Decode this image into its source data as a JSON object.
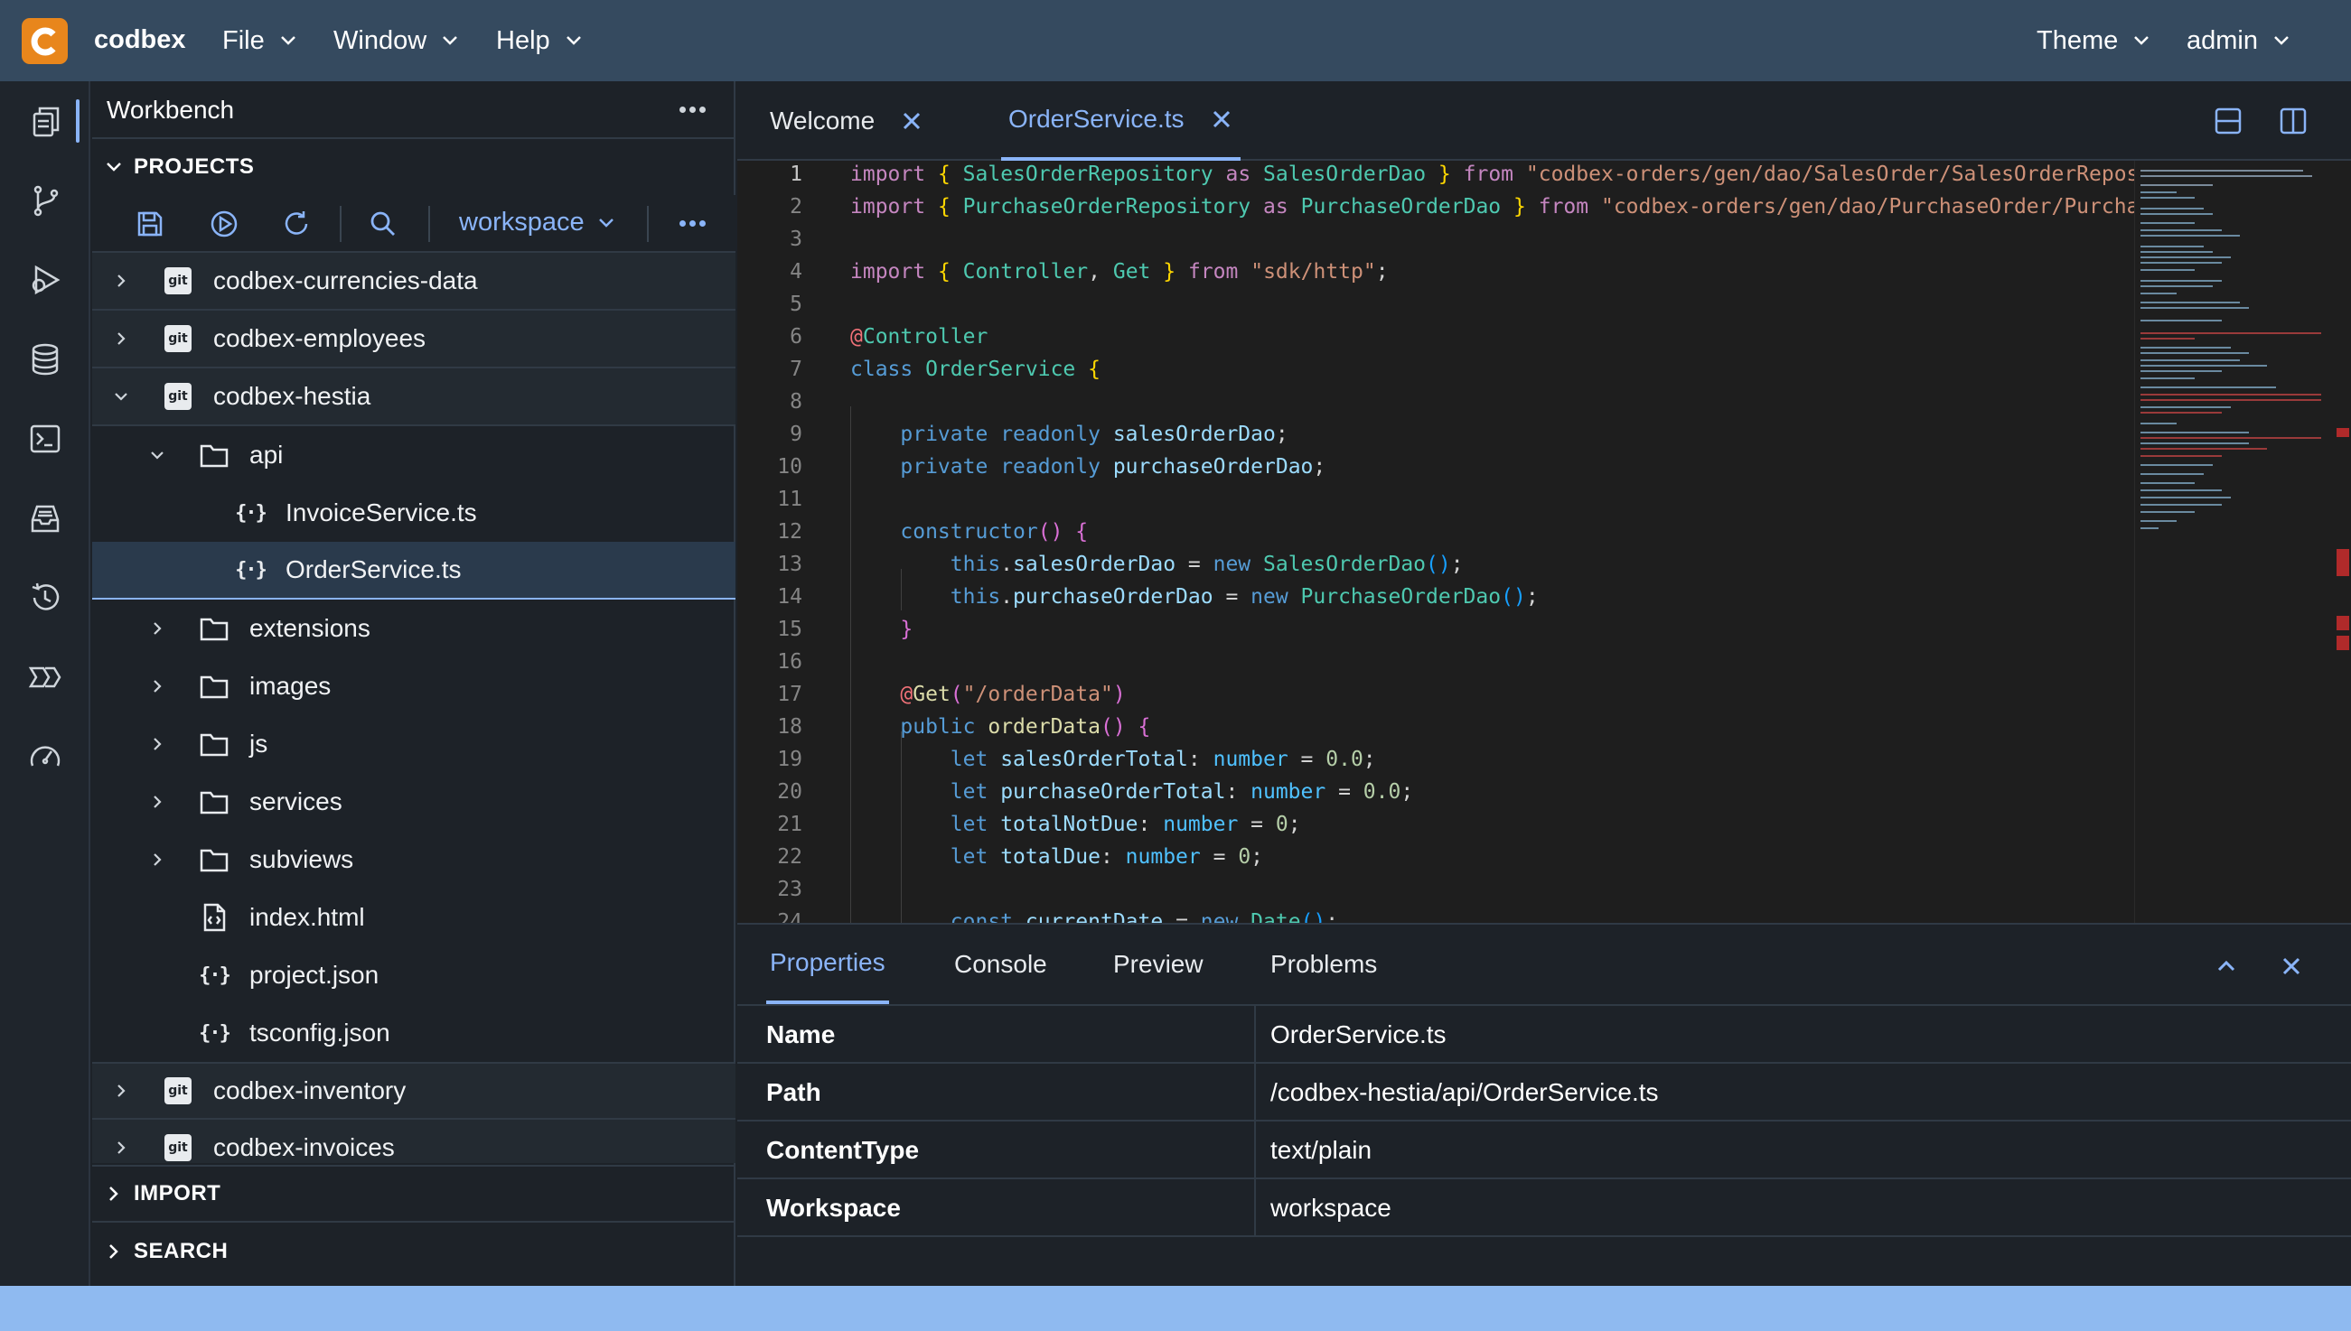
{
  "app": {
    "name": "codbex"
  },
  "menubar": {
    "file": "File",
    "window": "Window",
    "help": "Help",
    "theme": "Theme",
    "user": "admin"
  },
  "sidebar": {
    "title": "Workbench",
    "projects_label": "PROJECTS",
    "workspace": "workspace",
    "import_label": "IMPORT",
    "search_label": "SEARCH",
    "tree": [
      {
        "label": "codbex-currencies-data",
        "type": "project"
      },
      {
        "label": "codbex-employees",
        "type": "project"
      },
      {
        "label": "codbex-hestia",
        "type": "project"
      },
      {
        "label": "api",
        "type": "folder"
      },
      {
        "label": "InvoiceService.ts",
        "type": "file"
      },
      {
        "label": "OrderService.ts",
        "type": "file"
      },
      {
        "label": "extensions",
        "type": "folder"
      },
      {
        "label": "images",
        "type": "folder"
      },
      {
        "label": "js",
        "type": "folder"
      },
      {
        "label": "services",
        "type": "folder"
      },
      {
        "label": "subviews",
        "type": "folder"
      },
      {
        "label": "index.html",
        "type": "file"
      },
      {
        "label": "project.json",
        "type": "file"
      },
      {
        "label": "tsconfig.json",
        "type": "file"
      },
      {
        "label": "codbex-inventory",
        "type": "project"
      },
      {
        "label": "codbex-invoices",
        "type": "project"
      }
    ],
    "git_badge": "git"
  },
  "editor": {
    "tabs": [
      "Welcome",
      "OrderService.ts"
    ],
    "line_numbers": [
      "1",
      "2",
      "3",
      "4",
      "5",
      "6",
      "7",
      "8",
      "9",
      "10",
      "11",
      "12",
      "13",
      "14",
      "15",
      "16",
      "17",
      "18",
      "19",
      "20",
      "21",
      "22",
      "23",
      "24"
    ]
  },
  "panel": {
    "tabs": [
      "Properties",
      "Console",
      "Preview",
      "Problems"
    ],
    "properties": [
      {
        "key": "Name",
        "value": "OrderService.ts"
      },
      {
        "key": "Path",
        "value": "/codbex-hestia/api/OrderService.ts"
      },
      {
        "key": "ContentType",
        "value": "text/plain"
      },
      {
        "key": "Workspace",
        "value": "workspace"
      }
    ]
  },
  "colors": {
    "topbar": "#354a5f",
    "accent": "#8ab4f8",
    "logo": "#e8861c",
    "statusbar": "#8fbaf0"
  }
}
